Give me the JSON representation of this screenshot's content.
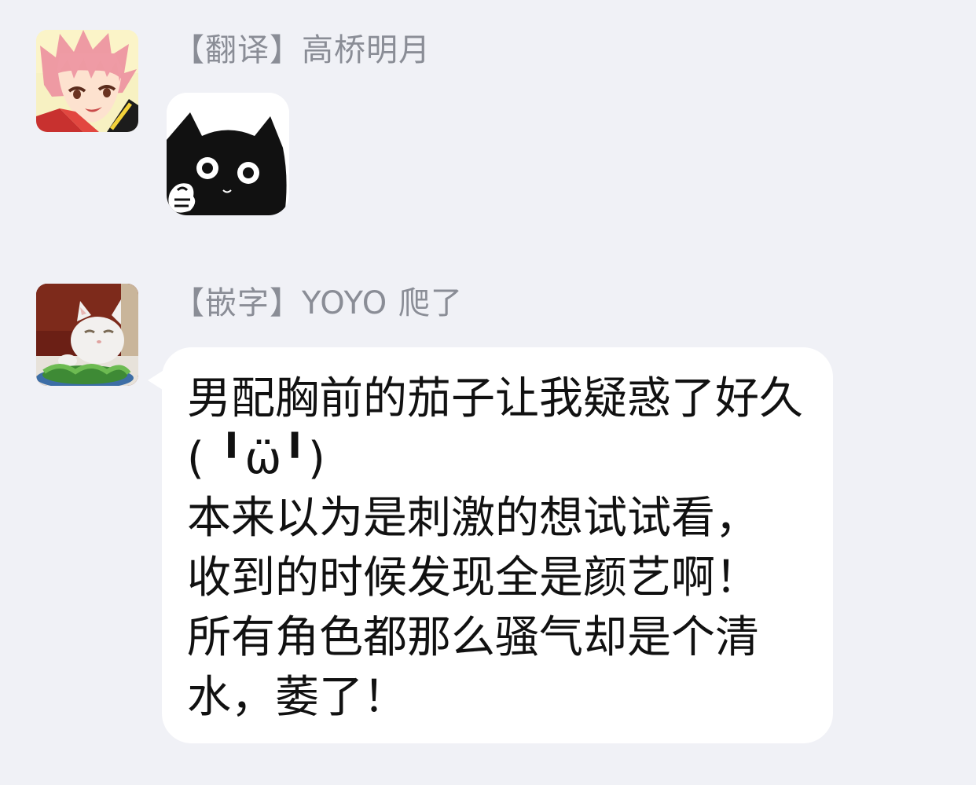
{
  "messages": [
    {
      "sender": "【翻译】高桥明月",
      "avatar_icon": "anime-boy-pink-hair-avatar",
      "content_type": "sticker",
      "sticker_icon": "black-cat-thumbs-up-sticker"
    },
    {
      "sender": "【嵌字】YOYO 爬了",
      "avatar_icon": "white-cat-at-table-avatar",
      "content_type": "text",
      "text": "男配胸前的茄子让我疑惑了好久( ╹ω̈╹)\n本来以为是刺激的想试试看，\n收到的时候发现全是颜艺啊！\n所有角色都那么骚气却是个清水，萎了！"
    }
  ],
  "colors": {
    "background": "#f0f1f6",
    "bubble": "#ffffff",
    "sender_name": "#8a8d96",
    "message_text": "#111111"
  }
}
